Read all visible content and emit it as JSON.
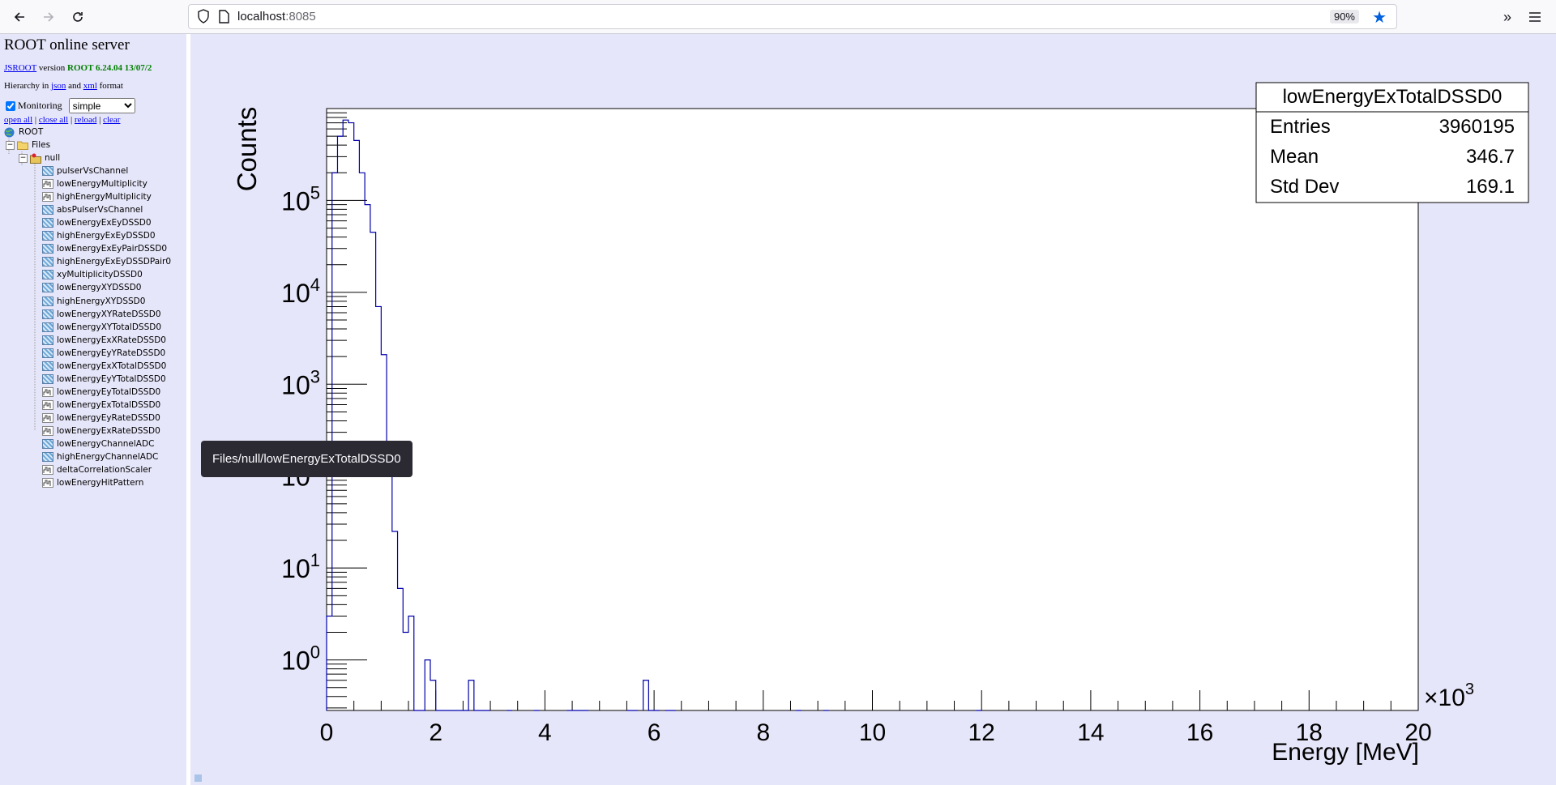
{
  "browser": {
    "url_host": "localhost",
    "url_port": ":8085",
    "zoom": "90%"
  },
  "sidebar": {
    "title": "ROOT online server",
    "jsroot_link": "JSROOT",
    "version_word": "version",
    "version_value": "ROOT 6.24.04 13/07/2",
    "hierarchy_prefix": "Hierarchy in",
    "json_link": "json",
    "and_word": "and",
    "xml_link": "xml",
    "format_word": "format",
    "monitoring_label": "Monitoring",
    "monitoring_value": "simple",
    "actions": [
      "open all",
      "close all",
      "reload",
      "clear"
    ],
    "root_label": "ROOT",
    "files_label": "Files",
    "null_label": "null",
    "items": [
      {
        "label": "pulserVsChannel",
        "kind": "h2"
      },
      {
        "label": "lowEnergyMultiplicity",
        "kind": "h1"
      },
      {
        "label": "highEnergyMultiplicity",
        "kind": "h1"
      },
      {
        "label": "absPulserVsChannel",
        "kind": "h2"
      },
      {
        "label": "lowEnergyExEyDSSD0",
        "kind": "h2"
      },
      {
        "label": "highEnergyExEyDSSD0",
        "kind": "h2"
      },
      {
        "label": "lowEnergyExEyPairDSSD0",
        "kind": "h2"
      },
      {
        "label": "highEnergyExEyDSSDPair0",
        "kind": "h2"
      },
      {
        "label": "xyMultiplicityDSSD0",
        "kind": "h2"
      },
      {
        "label": "lowEnergyXYDSSD0",
        "kind": "h2"
      },
      {
        "label": "highEnergyXYDSSD0",
        "kind": "h2"
      },
      {
        "label": "lowEnergyXYRateDSSD0",
        "kind": "h2"
      },
      {
        "label": "lowEnergyXYTotalDSSD0",
        "kind": "h2"
      },
      {
        "label": "lowEnergyExXRateDSSD0",
        "kind": "h2"
      },
      {
        "label": "lowEnergyEyYRateDSSD0",
        "kind": "h2"
      },
      {
        "label": "lowEnergyExXTotalDSSD0",
        "kind": "h2"
      },
      {
        "label": "lowEnergyEyYTotalDSSD0",
        "kind": "h2"
      },
      {
        "label": "lowEnergyEyTotalDSSD0",
        "kind": "h1"
      },
      {
        "label": "lowEnergyExTotalDSSD0",
        "kind": "h1"
      },
      {
        "label": "lowEnergyEyRateDSSD0",
        "kind": "h1"
      },
      {
        "label": "lowEnergyExRateDSSD0",
        "kind": "h1"
      },
      {
        "label": "lowEnergyChannelADC",
        "kind": "h2"
      },
      {
        "label": "highEnergyChannelADC",
        "kind": "h2"
      },
      {
        "label": "deltaCorrelationScaler",
        "kind": "h1"
      },
      {
        "label": "lowEnergyHitPattern",
        "kind": "h1"
      }
    ]
  },
  "tooltip": "Files/null/lowEnergyExTotalDSSD0",
  "stats": {
    "name": "lowEnergyExTotalDSSD0",
    "rows": [
      {
        "label": "Entries",
        "value": "3960195"
      },
      {
        "label": "Mean",
        "value": "346.7"
      },
      {
        "label": "Std Dev",
        "value": "169.1"
      }
    ]
  },
  "chart_data": {
    "type": "histogram",
    "xlabel": "Energy [MeV]",
    "ylabel": "Counts",
    "x_multiplier_label": "×10",
    "x_multiplier_exp": "3",
    "xlim": [
      0,
      20000
    ],
    "ylim_log10": [
      -0.55,
      6.0
    ],
    "log_y": true,
    "x_ticks": [
      0,
      2,
      4,
      6,
      8,
      10,
      12,
      14,
      16,
      18,
      20
    ],
    "y_tick_base": "10",
    "y_tick_exps": [
      "0",
      "1",
      "2",
      "3",
      "4",
      "5"
    ],
    "bin_width": 100,
    "bins": [
      [
        0,
        3
      ],
      [
        100,
        200000
      ],
      [
        200,
        500000
      ],
      [
        300,
        750000
      ],
      [
        400,
        700000
      ],
      [
        500,
        450000
      ],
      [
        600,
        200000
      ],
      [
        700,
        90000
      ],
      [
        800,
        45000
      ],
      [
        900,
        7000
      ],
      [
        1000,
        2100
      ],
      [
        1100,
        200
      ],
      [
        1200,
        25
      ],
      [
        1300,
        6
      ],
      [
        1400,
        2
      ],
      [
        1500,
        3
      ],
      [
        1600,
        0.01
      ],
      [
        1700,
        0.15
      ],
      [
        1800,
        1
      ],
      [
        1900,
        0.6
      ],
      [
        2000,
        0.15
      ],
      [
        2100,
        0.01
      ],
      [
        2200,
        0.15
      ],
      [
        2300,
        0.15
      ],
      [
        2400,
        0.15
      ],
      [
        2500,
        0.01
      ],
      [
        2600,
        0.6
      ],
      [
        2700,
        0.15
      ],
      [
        2800,
        0.01
      ],
      [
        2900,
        0.15
      ],
      [
        3300,
        0.15
      ],
      [
        3800,
        0.15
      ],
      [
        4400,
        0.15
      ],
      [
        4500,
        0.15
      ],
      [
        4600,
        0.15
      ],
      [
        4700,
        0.15
      ],
      [
        5500,
        0.15
      ],
      [
        5600,
        0.15
      ],
      [
        5800,
        0.6
      ],
      [
        5900,
        0.15
      ],
      [
        6000,
        0.15
      ],
      [
        6200,
        0.15
      ],
      [
        6300,
        0.15
      ],
      [
        8600,
        0.15
      ],
      [
        9100,
        0.15
      ],
      [
        11900,
        0.15
      ]
    ]
  }
}
